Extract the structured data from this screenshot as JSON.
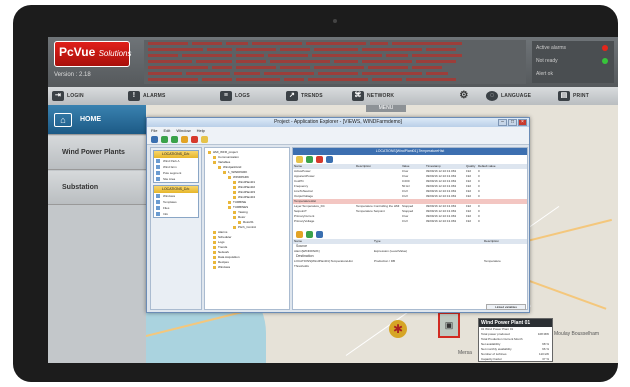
{
  "app": {
    "logo_main": "PcVue",
    "logo_sub": "Solutions",
    "version": "Version : 2.18"
  },
  "status_panel": {
    "line1": "Active alarms",
    "line2": "Not ready",
    "line3": "Alert ok"
  },
  "menu": {
    "items": [
      {
        "label": "LOGIN",
        "icon": "login-icon"
      },
      {
        "label": "ALARMS",
        "icon": "alarm-icon"
      },
      {
        "label": "LOGS",
        "icon": "log-icon"
      },
      {
        "label": "TRENDS",
        "icon": "trend-icon"
      },
      {
        "label": "NETWORK",
        "icon": "network-icon"
      },
      {
        "label": "LANGUAGE",
        "icon": "language-icon"
      },
      {
        "label": "PRINT",
        "icon": "print-icon"
      }
    ]
  },
  "nav": {
    "home": "HOME",
    "items": [
      "Wind Power Plants",
      "Substation"
    ]
  },
  "map": {
    "tab": "MENU",
    "labels": [
      "Mersa",
      "Moulay Bousselham"
    ],
    "popup": {
      "title": "Wind Power Plant 01",
      "rows": [
        {
          "k": "01 Wind Power Plant 01",
          "v": ""
        },
        {
          "k": "Total power produced",
          "v": "108 MW"
        },
        {
          "k": "Total Production Current Month",
          "v": ""
        },
        {
          "k": "Net availability",
          "v": "98 %"
        },
        {
          "k": "Net monthly availability",
          "v": "96 %"
        },
        {
          "k": "Number of turbines",
          "v": "110 kW"
        },
        {
          "k": "Capacity Factor",
          "v": "37 %"
        }
      ]
    }
  },
  "explorer": {
    "title": "Project - Application Explorer - [VIEWS, WINDFarmdemo]",
    "menu": [
      "File",
      "Edit",
      "Window",
      "Help"
    ],
    "left_groups": [
      {
        "title": "LOCATIONS_D/o",
        "items": [
          "Wind Park A",
          "Wind farm",
          "Pole segment",
          "Site Area"
        ]
      },
      {
        "title": "LOCATIONS_D/o",
        "items": [
          "Windows",
          "Templates",
          "Files",
          "Info"
        ]
      }
    ],
    "tree": [
      "HMI_WFR_project",
      "Communication",
      "Variables",
      "WindparkGrid",
      "1_WINDPARK",
      "WINDPARK",
      "WindPlant01",
      "WindPlant02",
      "WindPlant03",
      "WindPlant04",
      "TURBINE",
      "TURBINES",
      "Yawing",
      "Rotor",
      "Rotor01",
      "Pitch_Control",
      "Alarms",
      "Scheduler",
      "Logs",
      "Trends",
      "Network",
      "Data Acquisition",
      "Recipes",
      "Windows"
    ],
    "path": "LOCATIONS[WindPlant01].TemperatureHist",
    "columns": [
      "Name",
      "Description",
      "Value",
      "Timestamp",
      "Quality",
      "Default value"
    ],
    "rows": [
      [
        "ActivePower",
        "",
        "0 kw",
        "09/09/16 12:10:13.063",
        "192",
        "0"
      ],
      [
        "ApparentPower",
        "",
        "0 kw",
        "09/09/16 12:10:13.063",
        "192",
        "0"
      ],
      [
        "CosPhi",
        "",
        "0.000",
        "09/09/16 12:10:13.063",
        "192",
        "0"
      ],
      [
        "Frequency",
        "",
        "50 Hz",
        "09/09/16 12:10:13.063",
        "192",
        "0"
      ],
      [
        "LineToNeutral",
        "",
        "0 kV",
        "09/09/16 12:10:13.063",
        "192",
        "0"
      ],
      [
        "OutputVoltage",
        "",
        "0 kV",
        "09/09/16 12:10:13.063",
        "192",
        "0"
      ],
      [
        "TemperatureHist",
        "",
        "",
        "",
        "",
        ""
      ],
      [
        "Layer.Temperature_D4",
        "Temperature Controlling the HMI",
        "Stopped",
        "09/09/16 12:10:13.063",
        "192",
        "0"
      ],
      [
        "SetpointT",
        "Temperature Setpoint",
        "Stopped",
        "09/09/16 12:10:13.063",
        "192",
        "0"
      ],
      [
        "PrimaryCurrent",
        "",
        "0 kw",
        "09/09/16 12:10:13.063",
        "192",
        "0"
      ],
      [
        "PrimaryVoltage",
        "",
        "0 kV",
        "09/09/16 12:10:13.063",
        "192",
        "0"
      ]
    ],
    "bottom_columns": [
      "Name",
      "Type",
      "Description"
    ],
    "bottom_sections": [
      {
        "label": "Source",
        "rows": [
          [
            "Alarm[WINDPARK]",
            "Expression (Level/Value)",
            ""
          ]
        ]
      },
      {
        "label": "Destination",
        "rows": [
          [
            "LOCATIONS[WindPlant01].TemperatureHist",
            "Production / DB",
            "Temperature"
          ]
        ]
      },
      {
        "label": "",
        "rows": [
          [
            "Thresholds",
            "",
            ""
          ]
        ]
      }
    ],
    "status": "Linked variables"
  },
  "colors": {
    "accent": "#1c5a86",
    "brand_red": "#d12b22",
    "led_red": "#e4261b",
    "led_green": "#37c43a"
  }
}
